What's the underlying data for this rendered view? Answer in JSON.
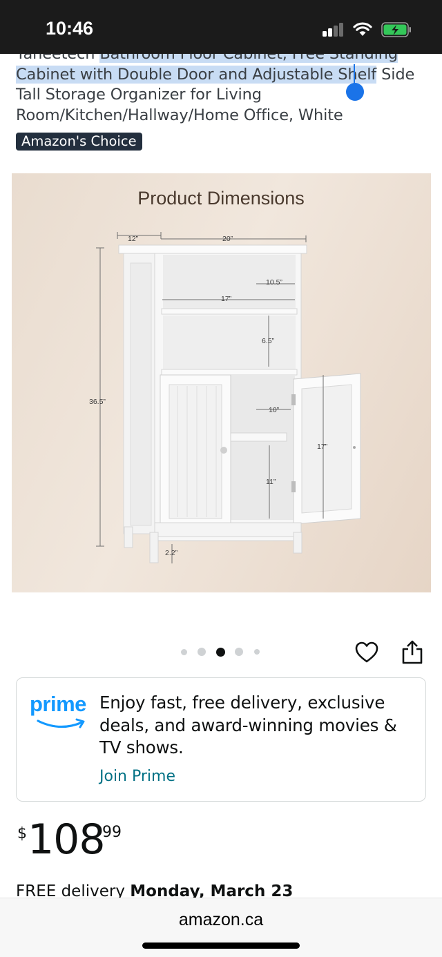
{
  "status_bar": {
    "time": "10:46"
  },
  "product": {
    "title_lead": "Yaheetech ",
    "title_highlight": "Bathroom Floor Cabinet, Free Standing Cabinet with Double Door and Adjustable Shelf",
    "title_tail": " Side Tall Storage Organizer for Living Room/Kitchen/Hallway/Home Office, White",
    "badge": "Amazon's Choice"
  },
  "image": {
    "heading": "Product Dimensions",
    "dims": {
      "depth": "12”",
      "width": "20”",
      "height": "36.5”",
      "top_shelf": "10.5”",
      "inner_width": "17”",
      "middle_shelf": "6.5”",
      "cabinet_depth": "10”",
      "lower_shelf": "11”",
      "door_height": "17”",
      "leg_height": "2.2”"
    },
    "carousel": {
      "count": 5,
      "active_index": 2
    }
  },
  "actions": {
    "wishlist_icon": "heart-icon",
    "share_icon": "share-icon"
  },
  "prime": {
    "logo_text": "prime",
    "description": "Enjoy fast, free delivery, exclusive deals, and award-winning movies & TV shows.",
    "link": "Join Prime",
    "brand_color": "#1399ff",
    "link_color": "#007185"
  },
  "price": {
    "symbol": "$",
    "whole": "108",
    "fraction": "99"
  },
  "delivery": {
    "prefix": "FREE delivery ",
    "date": "Monday, March 23"
  },
  "browser": {
    "url": "amazon.ca"
  }
}
